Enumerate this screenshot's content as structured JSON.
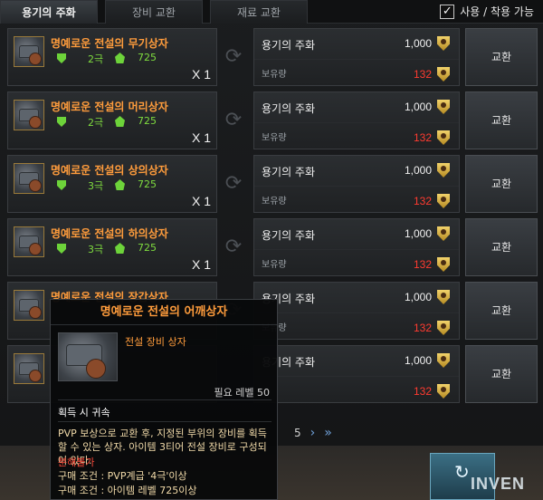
{
  "tabs": [
    {
      "label": "용기의 주화",
      "active": true
    },
    {
      "label": "장비 교환",
      "active": false
    },
    {
      "label": "재료 교환",
      "active": false
    }
  ],
  "filter": {
    "label": "사용 / 착용 가능",
    "checked": true,
    "check_mark": "✓"
  },
  "rows": [
    {
      "name": "명예로운 전설의 무기상자",
      "tier": "2극",
      "level": "725",
      "qty": "X 1",
      "currency": "용기의 주화",
      "cost": "1,000",
      "owned_label": "보유량",
      "owned": "132",
      "button": "교환"
    },
    {
      "name": "명예로운 전설의 머리상자",
      "tier": "2극",
      "level": "725",
      "qty": "X 1",
      "currency": "용기의 주화",
      "cost": "1,000",
      "owned_label": "보유량",
      "owned": "132",
      "button": "교환"
    },
    {
      "name": "명예로운 전설의 상의상자",
      "tier": "3극",
      "level": "725",
      "qty": "X 1",
      "currency": "용기의 주화",
      "cost": "1,000",
      "owned_label": "보유량",
      "owned": "132",
      "button": "교환"
    },
    {
      "name": "명예로운 전설의 하의상자",
      "tier": "3극",
      "level": "725",
      "qty": "X 1",
      "currency": "용기의 주화",
      "cost": "1,000",
      "owned_label": "보유량",
      "owned": "132",
      "button": "교환"
    },
    {
      "name": "명예로운 전설의 장갑상자",
      "tier": "",
      "level": "",
      "qty": "",
      "currency": "용기의 주화",
      "cost": "1,000",
      "owned_label": "보유량",
      "owned": "132",
      "button": "교환"
    },
    {
      "name": "",
      "tier": "",
      "level": "",
      "qty": "",
      "currency": "용기의 주화",
      "cost": "1,000",
      "owned_label": "",
      "owned": "132",
      "button": "교환"
    }
  ],
  "pager": {
    "page": "5",
    "next": "›",
    "last": "»"
  },
  "tooltip": {
    "title": "명예로운 전설의 어깨상자",
    "type": "전설 장비 상자",
    "required_level": "필요 레벨 50",
    "bind": "획득 시 귀속",
    "description": "PVP 보상으로 교환 후, 지정된 부위의 장비를 획득할 수 있는 상자. 아이템 3티어 전설 장비로 구성되어 있다.",
    "no_disassemble": "분해불가",
    "req1": "구매 조건 : PVP계급 '4극'이상",
    "req2": "구매 조건 : 아이템 레벨 725이상"
  },
  "watermark": "INVEN",
  "colors": {
    "accent": "#ff9c3c",
    "tier": "#7fdc3f",
    "owned": "#ff3b30",
    "pager": "#6fa0d8"
  }
}
